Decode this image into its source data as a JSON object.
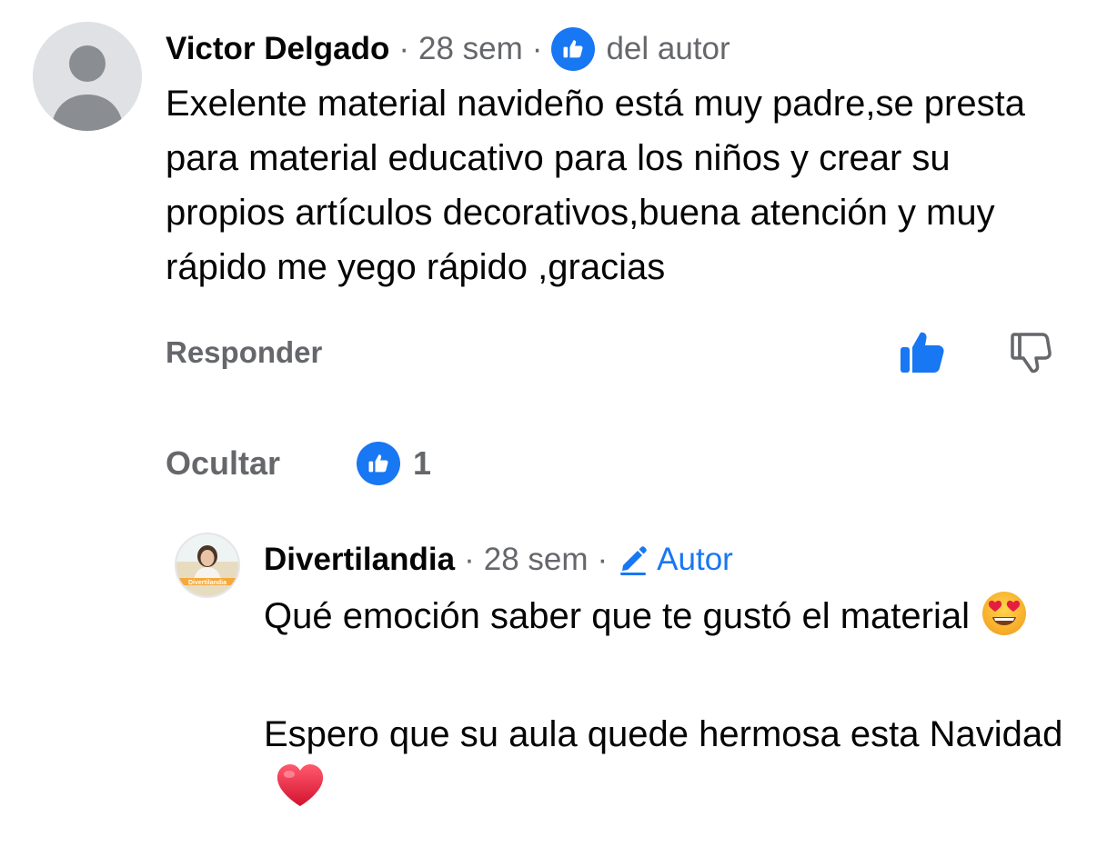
{
  "comment": {
    "author": "Victor Delgado",
    "time": "28 sem",
    "separator": "·",
    "author_liked_label": "del autor",
    "body": "Exelente material navideño está muy padre,se presta para material educativo para los niños y crear su propios artículos decorativos,buena atención y muy rápido me yego rápido ,gracias",
    "reply_label": "Responder",
    "hide_label": "Ocultar",
    "reaction_count": "1"
  },
  "reply": {
    "author": "Divertilandia",
    "time": "28 sem",
    "separator": "·",
    "author_badge": "Autor",
    "paragraph_1": "Qué emoción saber que te gustó el material",
    "paragraph_2": "Espero que su aula quede hermosa esta Navidad",
    "avatar_text": "Divertilandia"
  },
  "colors": {
    "accent": "#1877f2",
    "secondary_text": "#65676b",
    "primary_text": "#050505",
    "heart": "#e41e3f"
  },
  "icons": {
    "avatar": "default-user-avatar-icon",
    "like_badge": "thumbs-up-badge-icon",
    "like_action": "thumbs-up-filled-icon",
    "dislike_action": "thumbs-down-outline-icon",
    "author_badge": "pencil-icon",
    "emoji_1": "heart-eyes-emoji",
    "emoji_2": "red-heart-emoji"
  }
}
